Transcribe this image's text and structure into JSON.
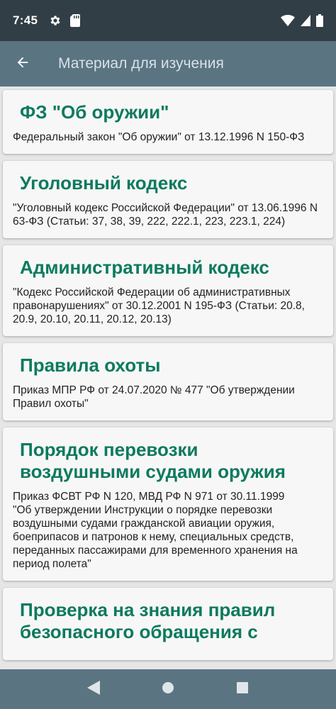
{
  "status_bar": {
    "time": "7:45",
    "icons": [
      "gear-icon",
      "sd-card-icon",
      "wifi-icon",
      "signal-icon",
      "battery-icon"
    ]
  },
  "app_bar": {
    "title": "Материал для изучения",
    "back_icon": "arrow-left-icon"
  },
  "cards": [
    {
      "title": "ФЗ \"Об оружии\"",
      "description": "Федеральный закон \"Об оружии\" от 13.12.1996 N 150-ФЗ"
    },
    {
      "title": "Уголовный кодекс",
      "description": "\"Уголовный кодекс Российской Федерации\" от 13.06.1996 N 63-ФЗ (Статьи: 37, 38, 39, 222, 222.1, 223, 223.1, 224)"
    },
    {
      "title": "Административный кодекс",
      "description": "\"Кодекс Российской Федерации об административных правонарушениях\" от 30.12.2001 N 195-ФЗ (Статьи: 20.8, 20.9, 20.10, 20.11, 20.12, 20.13)"
    },
    {
      "title": "Правила охоты",
      "description": "Приказ МПР РФ от 24.07.2020 № 477 \"Об утверждении Правил охоты\""
    },
    {
      "title": "Порядок перевозки воздушными судами оружия",
      "description": "Приказ ФСВТ РФ N 120, МВД РФ N 971 от 30.11.1999\n\"Об утверждении Инструкции о порядке перевозки воздушными судами гражданской авиации оружия, боеприпасов и патронов к нему, специальных средств, переданных пассажирами для временного хранения на период полета\""
    },
    {
      "title": "Проверка на знания правил безопасного обращения с",
      "description": ""
    }
  ],
  "colors": {
    "status_bar": "#323e45",
    "app_bar": "#5a7482",
    "title_green": "#0d7a5e",
    "background": "#e6e6e6"
  },
  "nav_bar": {
    "icons": [
      "back-triangle-icon",
      "home-circle-icon",
      "recents-square-icon"
    ]
  }
}
